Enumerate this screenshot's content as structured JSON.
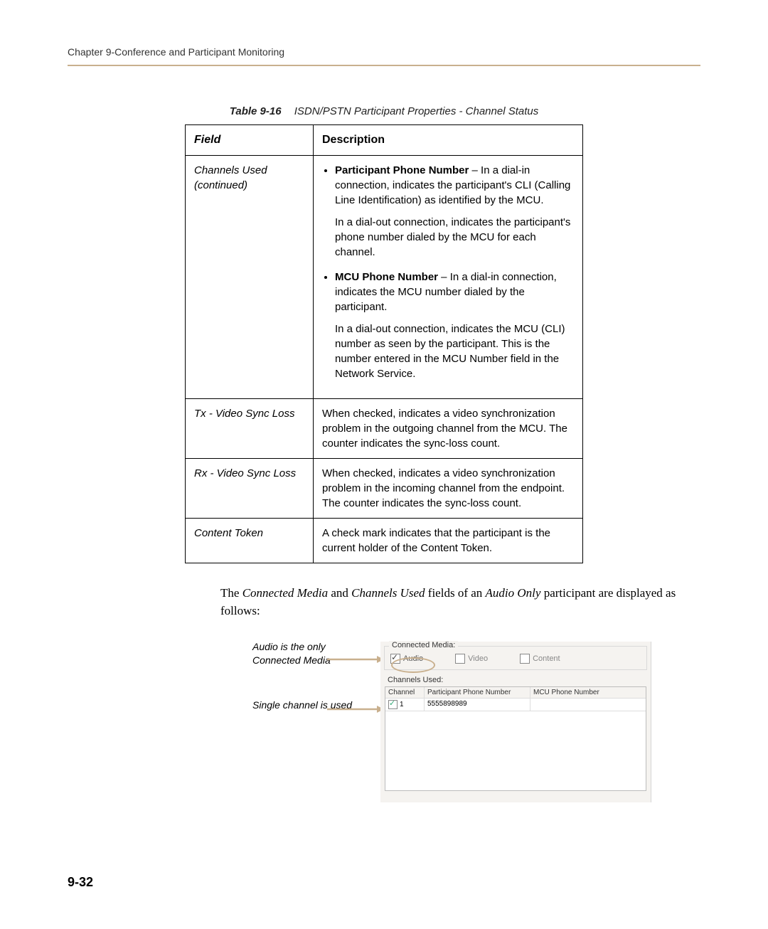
{
  "header": {
    "chapter_line": "Chapter 9-Conference and Participant Monitoring"
  },
  "table": {
    "caption_label": "Table 9-16",
    "caption_text": "ISDN/PSTN Participant Properties - Channel Status",
    "col_field": "Field",
    "col_desc": "Description",
    "rows": [
      {
        "field": "Channels Used (continued)",
        "bullets": [
          {
            "lead": "Participant Phone Number",
            "rest": " – In a dial-in connection, indicates the participant's CLI (Calling Line Identification) as identified by the MCU.",
            "para2": "In a dial-out connection, indicates the participant's phone number dialed by the MCU for each channel."
          },
          {
            "lead": "MCU Phone Number",
            "rest": " – In a dial-in connection, indicates the MCU number dialed by the participant.",
            "para2": "In a dial-out connection, indicates the MCU (CLI) number as seen by the participant. This is the number entered in the MCU Number field in the Network Service."
          }
        ]
      },
      {
        "field": "Tx - Video Sync Loss",
        "desc": "When checked, indicates a video synchronization problem in the outgoing channel from the MCU. The counter indicates the sync-loss count."
      },
      {
        "field": "Rx - Video Sync Loss",
        "desc": "When checked, indicates a video synchronization problem in the incoming channel from the endpoint. The counter indicates the sync-loss count."
      },
      {
        "field": "Content Token",
        "desc": "A check mark indicates that the participant is the current holder of the Content Token."
      }
    ]
  },
  "followup": {
    "pre": "The ",
    "em1": "Connected Media",
    "mid1": " and ",
    "em2": "Channels Used",
    "mid2": " fields of an ",
    "em3": "Audio Only",
    "post": " participant are displayed as follows:"
  },
  "annotations": {
    "a1": "Audio is the only Connected Media",
    "a2": "Single channel is used"
  },
  "panel": {
    "fieldset_label": "Connected Media:",
    "audio": "Audio",
    "video": "Video",
    "content": "Content",
    "channels_label": "Channels Used:",
    "headers": {
      "ch": "Channel",
      "pp": "Participant Phone Number",
      "mc": "MCU Phone Number"
    },
    "row": {
      "num": "1",
      "phone": "5555898989"
    }
  },
  "page_number": "9-32"
}
